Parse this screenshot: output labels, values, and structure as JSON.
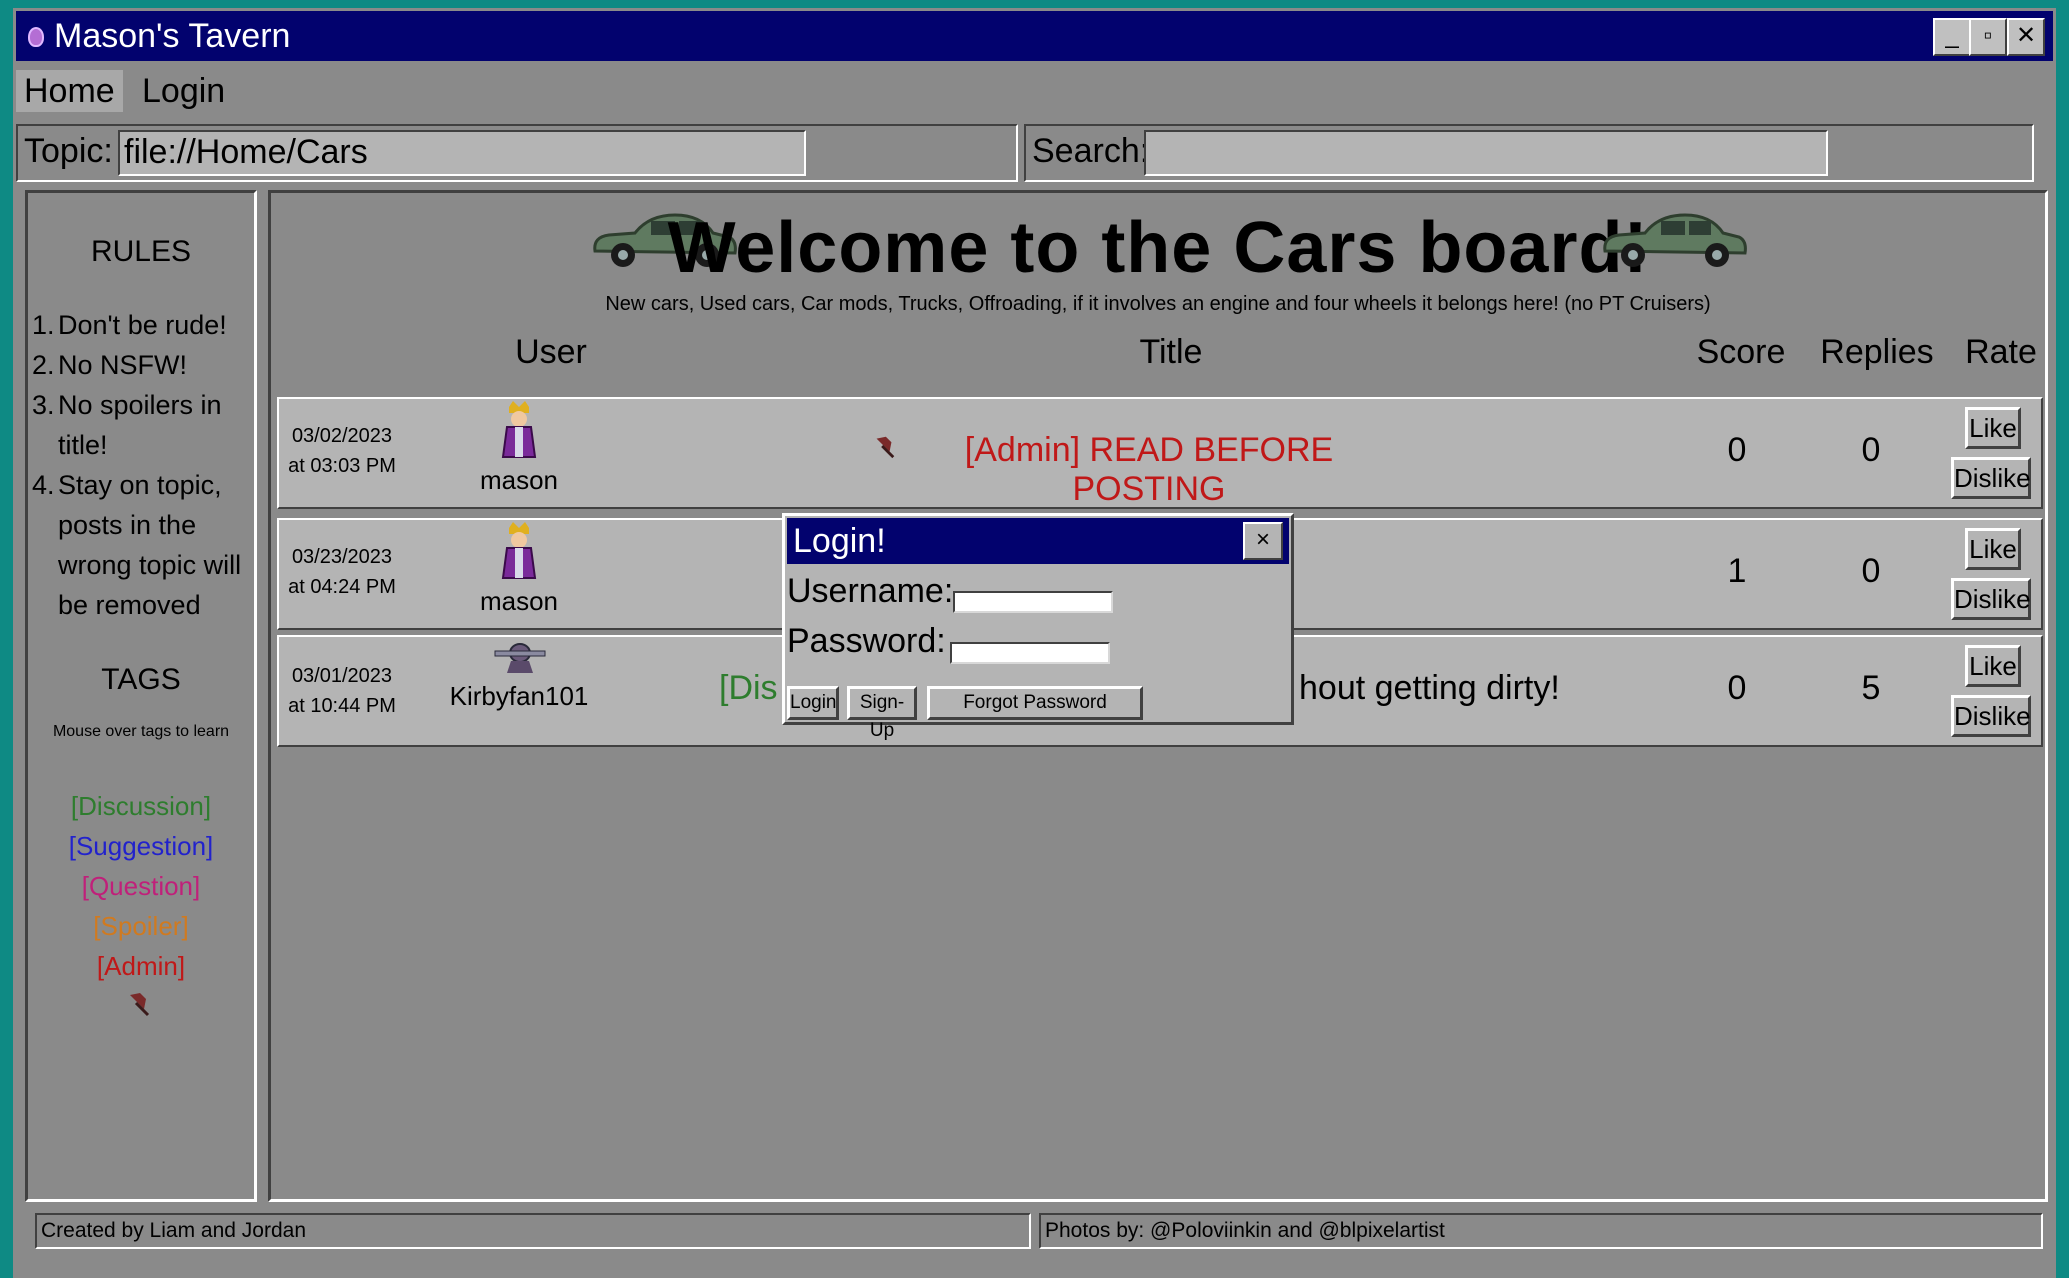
{
  "window": {
    "title": "Mason's Tavern",
    "minimize": "_",
    "maximize": "▫",
    "close": "✕"
  },
  "menu": {
    "home": "Home",
    "login": "Login"
  },
  "topic": {
    "label": "Topic:",
    "value": "file://Home/Cars"
  },
  "search": {
    "label": "Search:",
    "value": ""
  },
  "rules": {
    "heading": "RULES",
    "items": [
      {
        "num": "1.",
        "text": "Don't be rude!"
      },
      {
        "num": "2.",
        "text": "No NSFW!"
      },
      {
        "num": "3.",
        "text": "No spoilers in title!"
      },
      {
        "num": "4.",
        "text": "Stay on topic, posts in the wrong topic will be removed"
      }
    ]
  },
  "tags": {
    "heading": "TAGS",
    "note": "Mouse over tags to learn",
    "items": [
      {
        "label": "[Discussion]",
        "color": "#2e7d2e"
      },
      {
        "label": "[Suggestion]",
        "color": "#2222cc"
      },
      {
        "label": "[Question]",
        "color": "#c0207a"
      },
      {
        "label": "[Spoiler]",
        "color": "#d07a20"
      },
      {
        "label": "[Admin]",
        "color": "#c01818"
      }
    ],
    "pin_icon": "pushpin-icon"
  },
  "board": {
    "title": "Welcome to the Cars board!",
    "subtitle": "New cars, Used cars, Car mods, Trucks, Offroading, if it involves an engine and four wheels it belongs here! (no PT Cruisers)",
    "columns": {
      "user": "User",
      "title": "Title",
      "score": "Score",
      "replies": "Replies",
      "rate": "Rate"
    },
    "like_label": "Like",
    "dislike_label": "Dislike",
    "posts": [
      {
        "date": "03/02/2023",
        "time": "at 03:03 PM",
        "user": "mason",
        "title": "[Admin] READ BEFORE POSTING",
        "title_color": "#c01818",
        "pinned": true,
        "score": "0",
        "replies": "0"
      },
      {
        "date": "03/23/2023",
        "time": "at 04:24 PM",
        "user": "mason",
        "title": "",
        "title_color": "#000000",
        "pinned": false,
        "score": "1",
        "replies": "0"
      },
      {
        "date": "03/01/2023",
        "time": "at 10:44 PM",
        "user": "Kirbyfan101",
        "title_visible_left": "[Dis",
        "title_visible_right": "hout getting dirty!",
        "title_color": "#2e7d2e",
        "pinned": false,
        "score": "0",
        "replies": "5"
      }
    ]
  },
  "footer": {
    "credits": "Created by Liam and Jordan",
    "photos": "Photos by: @Poloviinkin and @blpixelartist"
  },
  "login_dialog": {
    "title": "Login!",
    "close": "×",
    "username_label": "Username:",
    "password_label": "Password:",
    "username_value": "",
    "password_value": "",
    "login_button": "Login",
    "signup_button": "Sign-Up",
    "forgot_button": "Forgot Password"
  },
  "colors": {
    "titlebar": "#02026e",
    "window": "#8a8a8a",
    "desktop": "#0e8a84",
    "row": "#b4b4b4"
  }
}
